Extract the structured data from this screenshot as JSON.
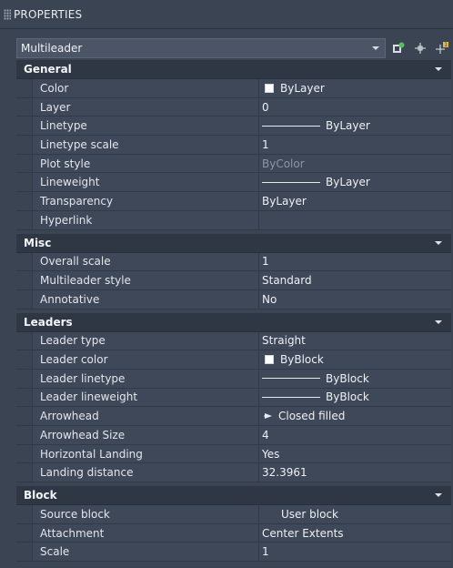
{
  "palette": {
    "title": "PROPERTIES"
  },
  "selector": {
    "value": "Multileader"
  },
  "sections": {
    "general": {
      "title": "General",
      "rows": [
        {
          "label": "Color",
          "value": "ByLayer"
        },
        {
          "label": "Layer",
          "value": "0"
        },
        {
          "label": "Linetype",
          "value": "ByLayer"
        },
        {
          "label": "Linetype scale",
          "value": "1"
        },
        {
          "label": "Plot style",
          "value": "ByColor"
        },
        {
          "label": "Lineweight",
          "value": "ByLayer"
        },
        {
          "label": "Transparency",
          "value": "ByLayer"
        },
        {
          "label": "Hyperlink",
          "value": ""
        }
      ]
    },
    "misc": {
      "title": "Misc",
      "rows": [
        {
          "label": "Overall scale",
          "value": "1"
        },
        {
          "label": "Multileader style",
          "value": "Standard"
        },
        {
          "label": "Annotative",
          "value": "No"
        }
      ]
    },
    "leaders": {
      "title": "Leaders",
      "rows": [
        {
          "label": "Leader type",
          "value": "Straight"
        },
        {
          "label": "Leader color",
          "value": "ByBlock"
        },
        {
          "label": "Leader linetype",
          "value": "ByBlock"
        },
        {
          "label": "Leader lineweight",
          "value": "ByBlock"
        },
        {
          "label": "Arrowhead",
          "value": "Closed filled"
        },
        {
          "label": "Arrowhead Size",
          "value": "4"
        },
        {
          "label": "Horizontal Landing",
          "value": "Yes"
        },
        {
          "label": "Landing distance",
          "value": "32.3961"
        }
      ]
    },
    "block": {
      "title": "Block",
      "rows": [
        {
          "label": "Source block",
          "value": "User block"
        },
        {
          "label": "Attachment",
          "value": "Center Extents"
        },
        {
          "label": "Scale",
          "value": "1"
        }
      ]
    }
  },
  "icons": [
    "quick-select-icon",
    "select-objects-icon",
    "toggle-pickadd-icon"
  ]
}
